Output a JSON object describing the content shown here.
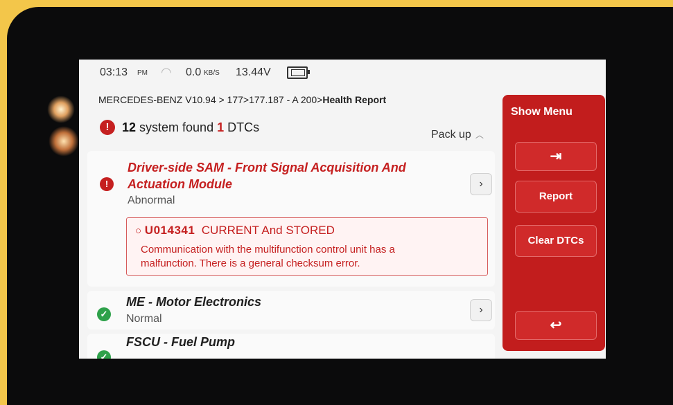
{
  "status_bar": {
    "time": "03:13",
    "ampm": "PM",
    "speed": "0.0",
    "speed_unit": "KB/S",
    "voltage": "13.44V",
    "wifi_icon": "wifi-icon",
    "battery_icon": "battery-icon"
  },
  "breadcrumb": {
    "path": "MERCEDES-BENZ V10.94 > 177>177.187 - A 200>",
    "current": "Health Report"
  },
  "summary": {
    "count": "12",
    "text_mid": " system found ",
    "dtc_count": "1",
    "text_end": " DTCs",
    "pack_up": "Pack up"
  },
  "systems": [
    {
      "name_line1": "Driver-side SAM - Front Signal Acquisition And",
      "name_line2": "Actuation Module",
      "status": "Abnormal",
      "dtc": {
        "code": "U014341",
        "state": "CURRENT And STORED",
        "description_line1": "Communication with the multifunction control unit has a",
        "description_line2": "malfunction. There is a general checksum error."
      }
    },
    {
      "name_line1": "ME - Motor Electronics",
      "status": "Normal"
    },
    {
      "name_line1": "FSCU - Fuel Pump",
      "status": ""
    }
  ],
  "menu": {
    "title": "Show Menu",
    "report": "Report",
    "clear_dtcs": "Clear DTCs"
  },
  "colors": {
    "accent_red": "#c21d1d",
    "error_red": "#c52020",
    "ok_green": "#2ea14a",
    "frame_yellow": "#f3c64a"
  }
}
